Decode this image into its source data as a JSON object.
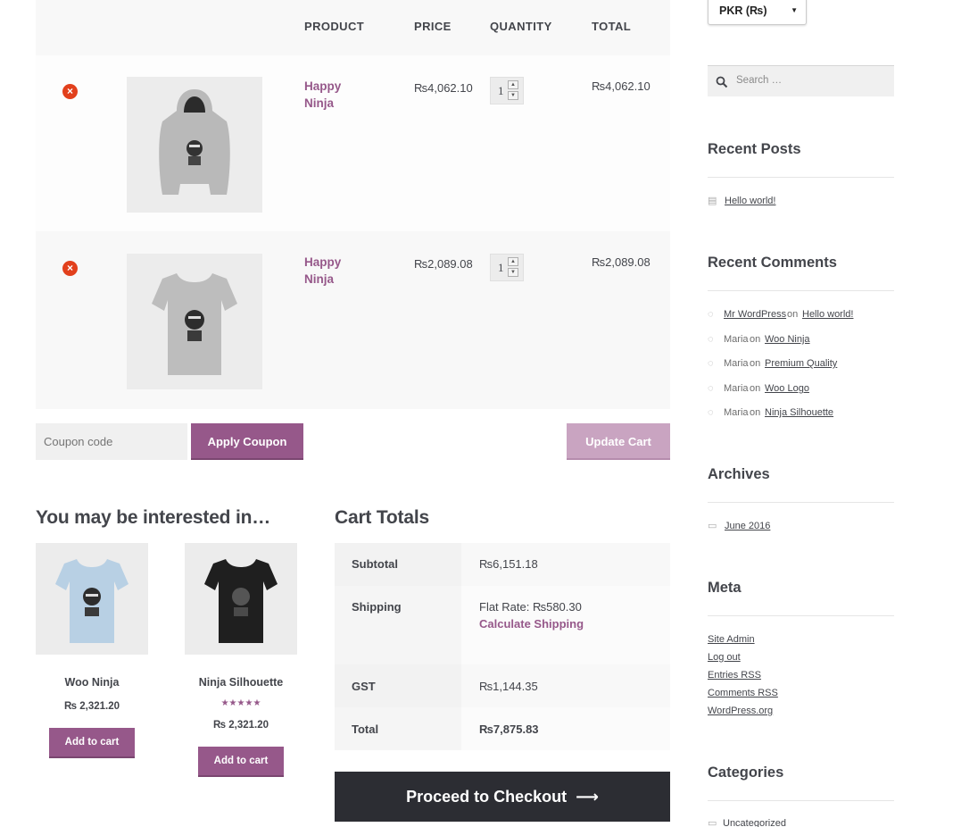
{
  "cart": {
    "headers": {
      "product": "PRODUCT",
      "price": "PRICE",
      "quantity": "QUANTITY",
      "total": "TOTAL"
    },
    "items": [
      {
        "name_line1": "Happy",
        "name_line2": "Ninja",
        "price": "₨4,062.10",
        "quantity": "1",
        "total": "₨4,062.10",
        "image": "grey-hoodie"
      },
      {
        "name_line1": "Happy",
        "name_line2": "Ninja",
        "price": "₨2,089.08",
        "quantity": "1",
        "total": "₨2,089.08",
        "image": "grey-tshirt"
      }
    ],
    "coupon_placeholder": "Coupon code",
    "apply_coupon_label": "Apply Coupon",
    "update_cart_label": "Update Cart"
  },
  "cross_sells": {
    "heading": "You may be interested in…",
    "products": [
      {
        "title": "Woo Ninja",
        "price": "₨ 2,321.20",
        "button": "Add to cart",
        "image": "light-blue-tshirt",
        "rating": null
      },
      {
        "title": "Ninja Silhouette",
        "price": "₨ 2,321.20",
        "button": "Add to cart",
        "image": "black-tshirt",
        "rating": "★★★★★"
      }
    ]
  },
  "cart_totals": {
    "heading": "Cart Totals",
    "subtotal_label": "Subtotal",
    "subtotal_value": "₨6,151.18",
    "shipping_label": "Shipping",
    "shipping_value": "Flat Rate: ₨580.30",
    "calculate_shipping": "Calculate Shipping",
    "gst_label": "GST",
    "gst_value": "₨1,144.35",
    "total_label": "Total",
    "total_value": "₨7,875.83",
    "checkout_label": "Proceed to Checkout",
    "checkout_arrow": "⟶"
  },
  "sidebar": {
    "currency": "PKR (₨)",
    "search_placeholder": "Search …",
    "recent_posts": {
      "title": "Recent Posts",
      "items": [
        "Hello world!"
      ]
    },
    "recent_comments": {
      "title": "Recent Comments",
      "items": [
        {
          "author": "Mr WordPress",
          "author_link": true,
          "on": "on",
          "post": "Hello world!"
        },
        {
          "author": "Maria",
          "author_link": false,
          "on": "on",
          "post": "Woo Ninja"
        },
        {
          "author": "Maria",
          "author_link": false,
          "on": "on",
          "post": "Premium Quality"
        },
        {
          "author": "Maria",
          "author_link": false,
          "on": "on",
          "post": "Woo Logo"
        },
        {
          "author": "Maria",
          "author_link": false,
          "on": "on",
          "post": "Ninja Silhouette"
        }
      ]
    },
    "archives": {
      "title": "Archives",
      "items": [
        "June 2016"
      ]
    },
    "meta": {
      "title": "Meta",
      "items": [
        "Site Admin",
        "Log out",
        "Entries RSS",
        "Comments RSS",
        "WordPress.org"
      ]
    },
    "categories": {
      "title": "Categories",
      "items": [
        "Uncategorized"
      ]
    }
  },
  "colors": {
    "accent": "#96588a",
    "remove": "#e2401c",
    "dark_button": "#2c2d33",
    "text": "#43454b"
  }
}
